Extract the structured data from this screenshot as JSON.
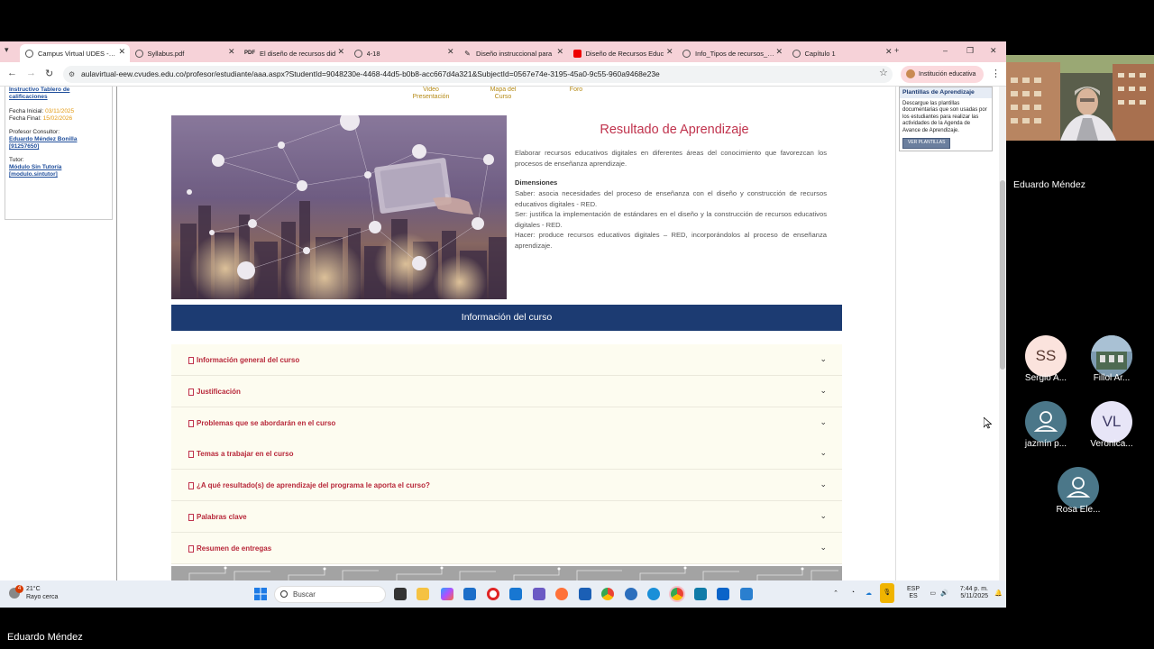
{
  "browser": {
    "tabs": [
      {
        "label": "Campus Virtual UDES - Tu",
        "icon": "globe-icon",
        "active": true
      },
      {
        "label": "Syllabus.pdf",
        "icon": "globe-icon",
        "active": false
      },
      {
        "label": "El diseño de recursos did",
        "icon": "pdf-icon",
        "icon_text": "PDF",
        "active": false
      },
      {
        "label": "4-18",
        "icon": "globe-icon",
        "active": false
      },
      {
        "label": "Diseño instruccional para",
        "icon": "pin-icon",
        "active": false
      },
      {
        "label": "Diseño de Recursos Educ",
        "icon": "youtube-icon",
        "active": false
      },
      {
        "label": "Info_Tipos de recursos_Ed",
        "icon": "globe-icon",
        "active": false
      },
      {
        "label": "Capítulo 1",
        "icon": "globe-icon",
        "active": false
      }
    ],
    "url": "aulavirtual-eew.cvudes.edu.co/profesor/estudiante/aaa.aspx?StudentId=9048230e-4468-44d5-b0b8-acc667d4a321&SubjectId=0567e74e-3195-45a0-9c55-960a9468e23e",
    "profile_label": "Institución educativa"
  },
  "left_panel": {
    "link_instructivo": "Instructivo Tablero de calificaciones",
    "fecha_inicial_label": "Fecha Inicial:",
    "fecha_inicial": "03/11/2025",
    "fecha_final_label": "Fecha Final:",
    "fecha_final": "15/02/2026",
    "profesor_label": "Profesor Consultor:",
    "profesor": "Eduardo Méndez Bonilla [91257650]",
    "tutor_label": "Tutor:",
    "tutor": "Módulo Sin Tutoría [modulo.sintutor]"
  },
  "top_links": {
    "video": "Video Presentación",
    "mapa": "Mapa del Curso",
    "foro": "Foro"
  },
  "resultado": {
    "title": "Resultado de Aprendizaje",
    "intro": "Elaborar recursos educativos digitales en diferentes áreas del conocimiento que favorezcan los procesos de enseñanza aprendizaje.",
    "dimensiones_title": "Dimensiones",
    "saber": "Saber: asocia necesidades del proceso de enseñanza con el diseño y construcción de recursos educativos digitales - RED.",
    "ser": "Ser: justifica la implementación de estándares en el diseño y la construcción de recursos educativos digitales - RED.",
    "hacer": "Hacer: produce recursos educativos digitales – RED, incorporándolos al proceso de enseñanza aprendizaje."
  },
  "info_banner": "Información del curso",
  "accordion": [
    "Información general del curso",
    "Justificación",
    "Problemas que se abordarán en el curso",
    "Temas a trabajar en el curso",
    "¿A qué resultado(s) de aprendizaje del programa le aporta el curso?",
    "Palabras clave",
    "Resumen de entregas"
  ],
  "plantillas": {
    "title": "Plantillas de Aprendizaje",
    "text": "Descargue las plantillas documentarias que son usadas por los estudiantes para realizar las actividades de la Agenda de Avance de Aprendizaje.",
    "button": "VER PLANTILLAS"
  },
  "taskbar": {
    "weather_badge": "4",
    "temperature": "21°C",
    "weather_text": "Rayo cerca",
    "search_placeholder": "Buscar",
    "lang_top": "ESP",
    "lang_bottom": "ES",
    "time": "7:44 p. m.",
    "date": "5/11/2025"
  },
  "meeting": {
    "speaker_name": "Eduardo Méndez",
    "presenter_name": "Eduardo Méndez",
    "participants": [
      {
        "initials": "SS",
        "name": "Sergio A...",
        "avatar_color": "#fbe3dd",
        "text_color": "#5a3a32"
      },
      {
        "initials": "",
        "name": "Fillol Ar...",
        "avatar_color": "#6b8aa3",
        "photo": true
      },
      {
        "initials": "",
        "name": "jazmín p...",
        "avatar_color": "#4b7789",
        "person_icon": true
      },
      {
        "initials": "VL",
        "name": "Veronica...",
        "avatar_color": "#e7e5f7",
        "text_color": "#3e3a66"
      },
      {
        "initials": "",
        "name": "Rosa Ele...",
        "avatar_color": "#4b7789",
        "person_icon": true
      }
    ]
  }
}
